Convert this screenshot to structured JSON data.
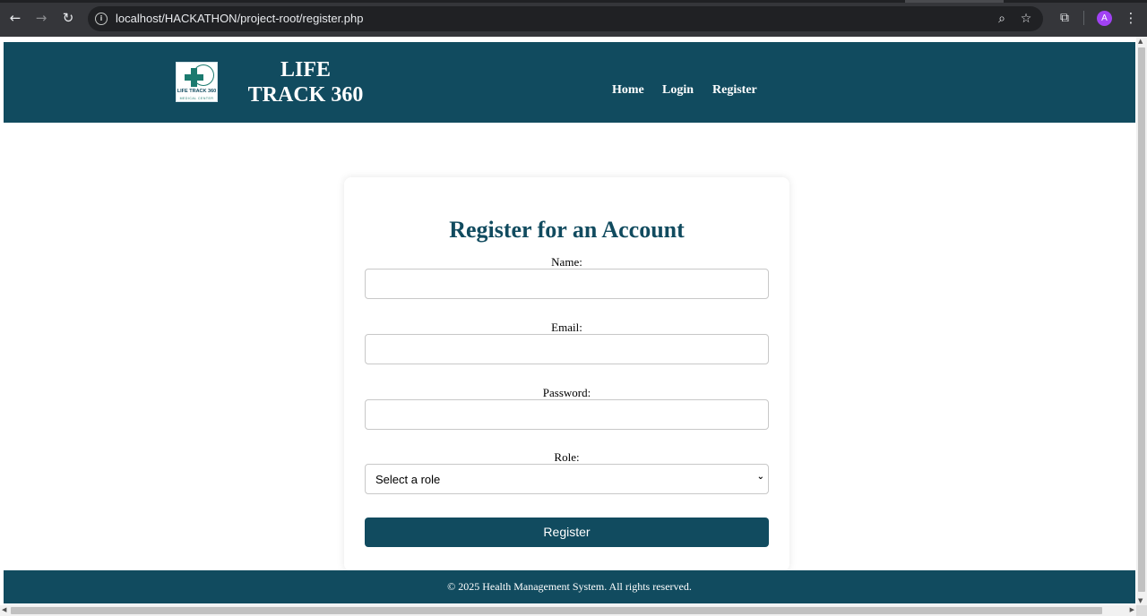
{
  "browser": {
    "url": "localhost/HACKATHON/project-root/register.php",
    "back_icon": "arrow-left-icon",
    "forward_icon": "arrow-right-icon",
    "reload_icon": "reload-icon",
    "site_info_icon": "info-icon",
    "zoom_icon": "zoom-icon",
    "bookmark_icon": "star-icon",
    "extensions_icon": "puzzle-icon",
    "profile_initial": "A",
    "profile_color": "#a142f4",
    "menu_icon": "more-vert-icon"
  },
  "header": {
    "title_line1": "LIFE",
    "title_line2": "TRACK 360",
    "logo_text": "LIFE TRACK 360",
    "logo_subtext": "MEDICAL CENTER",
    "nav": {
      "home": "Home",
      "login": "Login",
      "register": "Register"
    },
    "bg_color": "#114b5f"
  },
  "form": {
    "title": "Register for an Account",
    "name_label": "Name:",
    "name_value": "",
    "email_label": "Email:",
    "email_value": "",
    "password_label": "Password:",
    "password_value": "",
    "role_label": "Role:",
    "role_selected": "Select a role",
    "submit_label": "Register"
  },
  "footer": {
    "text": "© 2025 Health Management System. All rights reserved."
  }
}
